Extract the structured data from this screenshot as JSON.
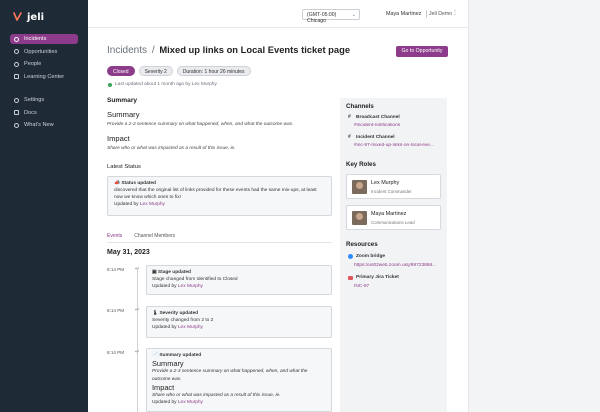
{
  "app": {
    "logo_text": "jeli"
  },
  "sidebar": {
    "items": [
      {
        "label": "Incidents",
        "icon": "alert-icon",
        "active": true
      },
      {
        "label": "Opportunities",
        "icon": "lightbulb-icon",
        "active": false
      },
      {
        "label": "People",
        "icon": "person-icon",
        "active": false
      },
      {
        "label": "Learning Center",
        "icon": "book-icon",
        "active": false
      }
    ],
    "bottom_items": [
      {
        "label": "Settings",
        "icon": "gear-icon"
      },
      {
        "label": "Docs",
        "icon": "document-icon"
      },
      {
        "label": "What's New",
        "icon": "sparkle-icon"
      }
    ]
  },
  "topbar": {
    "timezone": "(GMT-05:00) Chicago",
    "user_name": "Maya Martinez",
    "org_name": "Jeli Demo"
  },
  "page": {
    "breadcrumb_root": "Incidents",
    "separator": "/",
    "title": "Mixed up links on Local Events ticket page",
    "opportunity_button": "Go to Opportunity",
    "pills": [
      "Closed",
      "Severity 2",
      "Duration: 1 hour 26 minutes"
    ],
    "last_updated": "Last updated about 1 month ago by Lex Murphy"
  },
  "summary": {
    "section_title": "Summary",
    "heading": "Summary",
    "summary_prompt": "Provide a 2-3 sentence summary on what happened, when, and what the outcome was.",
    "impact_heading": "Impact",
    "impact_prompt": "Share who or what was impacted as a result of this issue, ie."
  },
  "latest_status": {
    "title": "Latest Status",
    "card_title": "Status updated",
    "body": "discovered that the original list of links provided for these events had the same mix-ups, at least now we know which ones to fix!",
    "updated_by_prefix": "Updated by",
    "updated_by": "Lex Murphy"
  },
  "tabs": [
    "Events",
    "Channel Members"
  ],
  "events": {
    "date": "May 31, 2023",
    "items": [
      {
        "time": "8:14 PM",
        "title": "Stage updated",
        "detail": "Stage changed from Identified to Closed",
        "by_prefix": "Updated by",
        "by": "Lex Murphy"
      },
      {
        "time": "8:14 PM",
        "title": "Severity updated",
        "detail": "Severity changed from 2 to 2",
        "by_prefix": "Updated by",
        "by": "Lex Murphy"
      },
      {
        "time": "8:14 PM",
        "title": "Summary updated",
        "summary_heading": "Summary",
        "summary_text": "Provide a 2-3 sentence summary on what happened, when, and what the outcome was.",
        "impact_heading": "Impact",
        "impact_text": "Share who or what was impacted as a result of this issue, ie.",
        "by_prefix": "Updated by",
        "by": "Lex Murphy"
      }
    ]
  },
  "panel": {
    "channels_title": "Channels",
    "broadcast_label": "Broadcast Channel",
    "broadcast_link": "#incident-notifications",
    "incident_label": "Incident Channel",
    "incident_link": "#inc-97-mixed-up-links-on-local-eve...",
    "roles_title": "Key Roles",
    "roles": [
      {
        "name": "Lex Murphy",
        "role": "Incident Commander"
      },
      {
        "name": "Maya Martinez",
        "role": "Communications Lead"
      }
    ],
    "resources_title": "Resources",
    "zoom_label": "Zoom bridge",
    "zoom_link": "https://us02web.zoom.us/j/89723886...",
    "jira_label": "Primary Jira Ticket",
    "jira_link": "INC-97"
  },
  "colors": {
    "accent": "#8c3c8a",
    "sidebar_bg": "#1f2a37"
  }
}
